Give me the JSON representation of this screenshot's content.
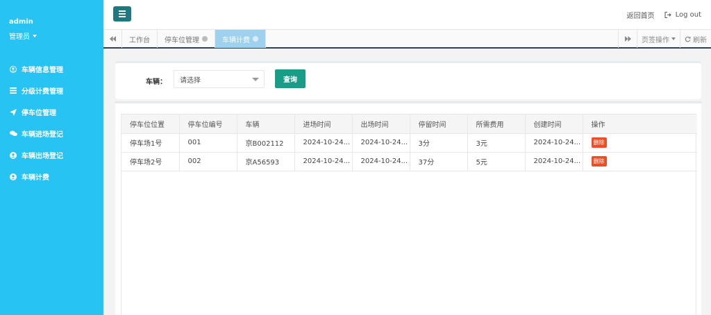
{
  "sidebar": {
    "username": "admin",
    "role": "管理员",
    "items": [
      {
        "label": "车辆信息管理",
        "icon": "user-circle-icon"
      },
      {
        "label": "分级计费管理",
        "icon": "list-icon"
      },
      {
        "label": "停车位管理",
        "icon": "paper-plane-icon"
      },
      {
        "label": "车辆进场登记",
        "icon": "comments-icon"
      },
      {
        "label": "车辆出场登记",
        "icon": "user-circle-icon"
      },
      {
        "label": "车辆计费",
        "icon": "user-circle-icon"
      }
    ]
  },
  "header": {
    "home_link": "返回首页",
    "logout": "Log out"
  },
  "tabs": {
    "items": [
      {
        "label": "工作台",
        "closable": false,
        "active": false
      },
      {
        "label": "停车位管理",
        "closable": true,
        "active": false
      },
      {
        "label": "车辆计费",
        "closable": true,
        "active": true
      }
    ],
    "page_ops": "页签操作",
    "refresh": "刷新"
  },
  "search": {
    "label": "车辆：",
    "select_value": "请选择",
    "button": "查询"
  },
  "table": {
    "headers": [
      "停车位位置",
      "停车位编号",
      "车辆",
      "进场时间",
      "出场时间",
      "停留时间",
      "所需费用",
      "创建时间",
      "操作"
    ],
    "rows": [
      [
        "停车场1号",
        "001",
        "京B002112",
        "2024-10-24...",
        "2024-10-24...",
        "3分",
        "3元",
        "2024-10-24..."
      ],
      [
        "停车场2号",
        "002",
        "京A56593",
        "2024-10-24...",
        "2024-10-24...",
        "37分",
        "5元",
        "2024-10-24..."
      ]
    ],
    "delete_label": "删除"
  },
  "colors": {
    "sidebar": "#27c3f3",
    "hamburger": "#1f7a7f",
    "primary": "#1a9d86",
    "danger": "#ec4f24",
    "active_tab": "#9ed1ee"
  }
}
